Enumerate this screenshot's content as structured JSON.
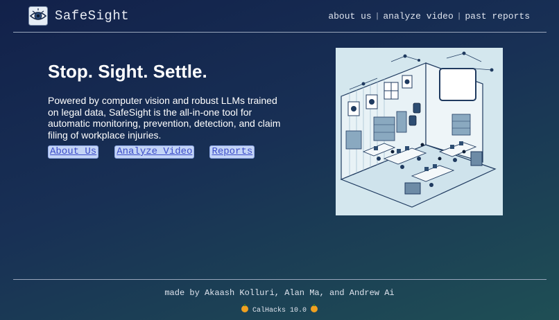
{
  "header": {
    "brand": "SafeSight",
    "logo_icon": "eye-icon",
    "nav": [
      {
        "label": "about us"
      },
      {
        "label": "analyze video"
      },
      {
        "label": "past reports"
      }
    ],
    "nav_separator": "|"
  },
  "hero": {
    "title": "Stop. Sight. Settle.",
    "description": "Powered by computer vision and robust LLMs trained on legal data, SafeSight is the all-in-one tool for automatic monitoring, prevention, detection, and claim filing of workplace injuries.",
    "buttons": [
      {
        "label": "About Us"
      },
      {
        "label": "Analyze Video"
      },
      {
        "label": "Reports"
      }
    ],
    "image_icon": "isometric-office-illustration"
  },
  "footer": {
    "credit": "made by Akaash Kolluri, Alan Ma, and Andrew Ai",
    "event": "CalHacks 10.0",
    "event_icon": "pumpkin-icon"
  },
  "colors": {
    "background_start": "#12214a",
    "background_end": "#1f4f55",
    "link_bg": "#c3d4f6",
    "link_text": "#3c4cc8"
  }
}
